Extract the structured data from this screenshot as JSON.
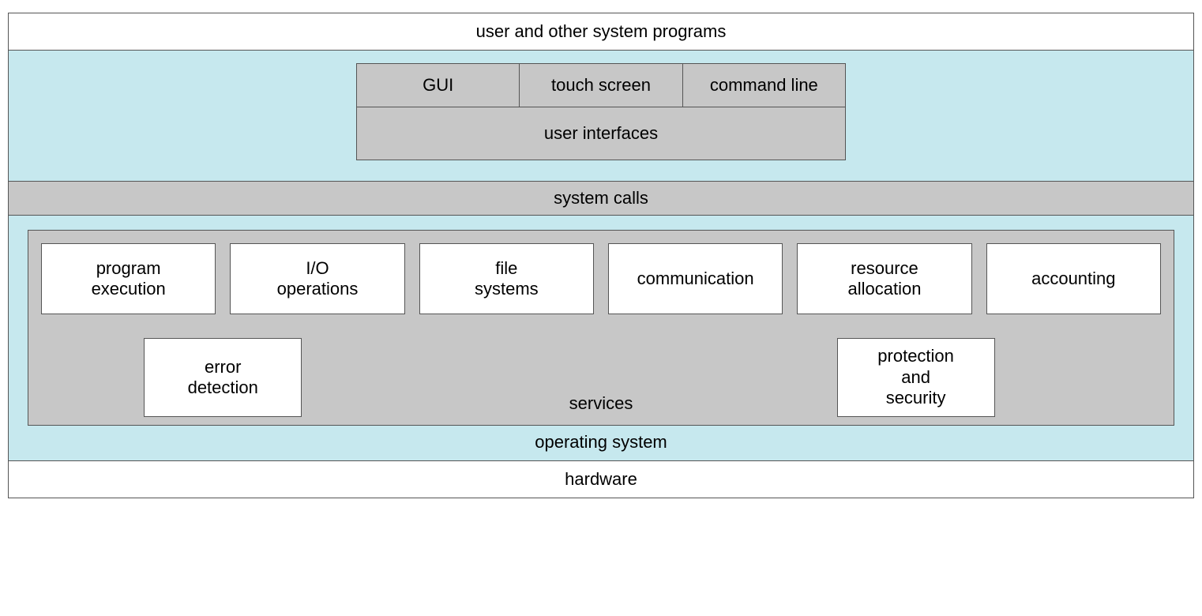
{
  "layers": {
    "top": "user and other system programs",
    "ui_types": [
      "GUI",
      "touch screen",
      "command line"
    ],
    "ui_label": "user interfaces",
    "syscalls": "system calls",
    "services_row1": [
      "program\nexecution",
      "I/O\noperations",
      "file\nsystems",
      "communication",
      "resource\nallocation",
      "accounting"
    ],
    "services_row2_left": "error\ndetection",
    "services_row2_right": "protection\nand\nsecurity",
    "services_label": "services",
    "os_label": "operating system",
    "hardware": "hardware"
  }
}
